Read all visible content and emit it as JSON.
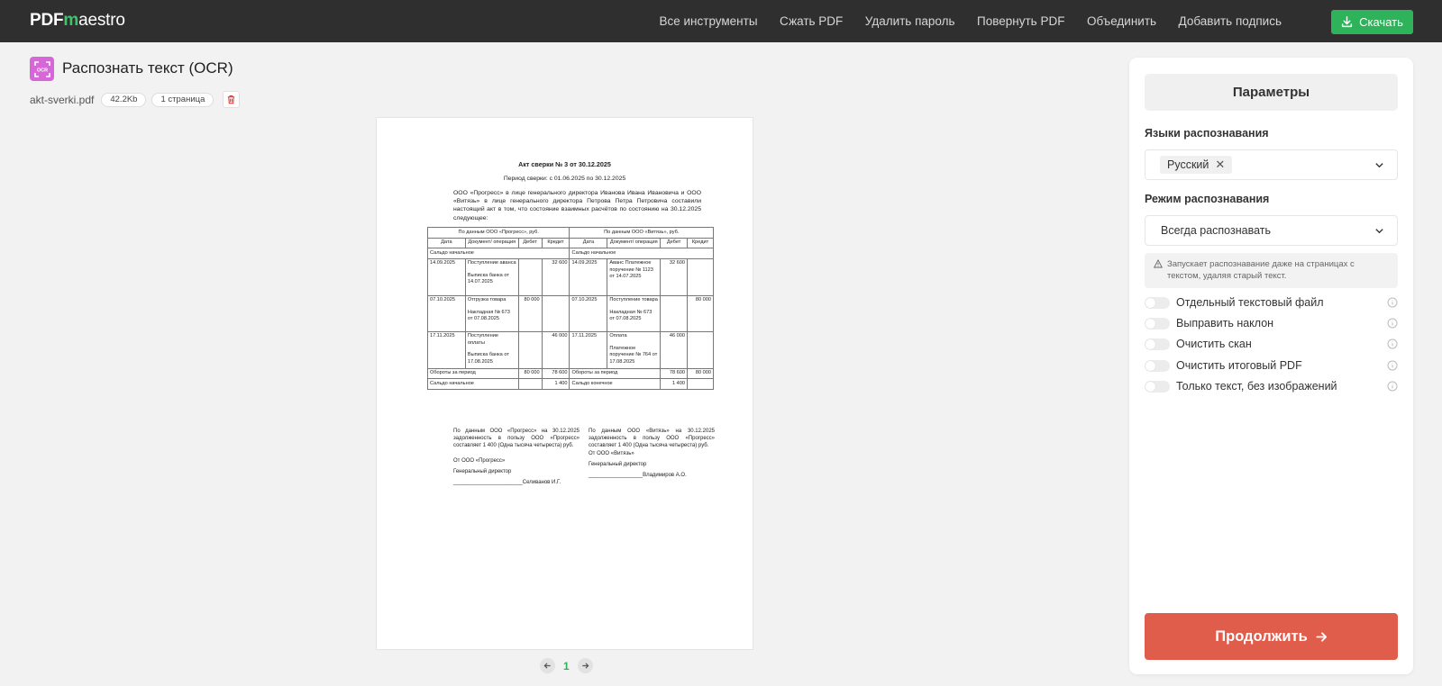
{
  "brand": {
    "logo_prefix": "PDF",
    "logo_m": "m",
    "logo_rest": "aestro"
  },
  "nav": {
    "items": [
      "Все инструменты",
      "Сжать PDF",
      "Удалить пароль",
      "Повернуть PDF",
      "Объединить",
      "Добавить подпись"
    ],
    "download_label": "Скачать"
  },
  "tool": {
    "title": "Распознать текст (OCR)",
    "icon_text": "OCR",
    "file_name": "akt-sverki.pdf",
    "file_size": "42.2Kb",
    "pages": "1 страница"
  },
  "document": {
    "title": "Акт сверки № 3 от 30.12.2025",
    "period": "Период сверки: с 01.06.2025 по 30.12.2025",
    "intro": "ООО «Прогресс» в лице генерального директора Иванова Ивана Ивановича и ООО «Витязь» в лице генерального директора Петрова Петра Петровича составили настоящий акт в том, что состояние взаимных расчётов по состоянию на 30.12.2025 следующее:",
    "left_header": "По данным ООО «Прогресс», руб.",
    "right_header": "По данным ООО «Витязь», руб.",
    "col_date": "Дата",
    "col_doc": "Документ/ операция",
    "col_debit": "Дебет",
    "col_credit": "Кредит",
    "opening": "Сальдо начальное",
    "rows": [
      {
        "l_date": "14.09.2025",
        "l_doc1": "Поступление аванса",
        "l_doc2": "Выписка банка от 14.07.2025",
        "l_debit": "",
        "l_credit": "32 600",
        "r_date": "14.09.2025",
        "r_doc1": "Аванс Платежное поручение № 1123 от 14.07.2025",
        "r_doc2": "",
        "r_debit": "32 600",
        "r_credit": ""
      },
      {
        "l_date": "07.10.2025",
        "l_doc1": "Отгрузка товара",
        "l_doc2": "Накладная № 673 от 07.08.2025",
        "l_debit": "80 000",
        "l_credit": "",
        "r_date": "07.10.2025",
        "r_doc1": "Поступление товара",
        "r_doc2": "Накладная № 673 от 07.08.2025",
        "r_debit": "",
        "r_credit": "80 000"
      },
      {
        "l_date": "17.11.2025",
        "l_doc1": "Поступление оплаты",
        "l_doc2": "Выписка банка от 17.08.2025",
        "l_debit": "",
        "l_credit": "46 000",
        "r_date": "17.11.2025",
        "r_doc1": "Оплата",
        "r_doc2": "Платежное поручение № 764 от 17.08.2025",
        "r_debit": "46 000",
        "r_credit": ""
      }
    ],
    "turnover_label": "Обороты за период",
    "turnover": {
      "l_debit": "80 000",
      "l_credit": "78 600",
      "r_debit": "78 600",
      "r_credit": "80 000"
    },
    "closing_left_label": "Сальдо начальное",
    "closing_right_label": "Сальдо конечное",
    "closing": {
      "l_credit": "1 400",
      "r_debit": "1 400"
    },
    "left_summary": "По данным ООО «Прогресс» на 30.12.2025 задолженность в пользу ООО «Прогресс» составляет 1 400 (Одна тысяча четыреста) руб.",
    "right_summary": "По данным ООО «Витязь» на 30.12.2025 задолженность в пользу ООО «Прогресс» составляет 1 400 (Одна тысяча четыреста) руб.",
    "left_from": "От ООО «Прогресс»",
    "right_from": "От ООО «Витязь»",
    "left_role": "Генеральный директор",
    "right_role": "Генеральный директор",
    "left_sign": "_______________________Селиванов И.Г.",
    "right_sign": "__________________Владимиров А.О."
  },
  "pager": {
    "current": "1"
  },
  "panel": {
    "title": "Параметры",
    "languages_label": "Языки распознавания",
    "language_selected": "Русский",
    "mode_label": "Режим распознавания",
    "mode_value": "Всегда распознавать",
    "mode_hint": "Запускает распознавание даже на страницах с текстом, удаляя старый текст.",
    "toggles": [
      "Отдельный текстовый файл",
      "Выправить наклон",
      "Очистить скан",
      "Очистить итоговый PDF",
      "Только текст, без изображений"
    ],
    "continue_label": "Продолжить"
  },
  "colors": {
    "accent_green": "#2fb35a",
    "continue_red": "#e05c4b",
    "topbar": "#2f2f30",
    "ocr_icon": "#d766d9"
  }
}
